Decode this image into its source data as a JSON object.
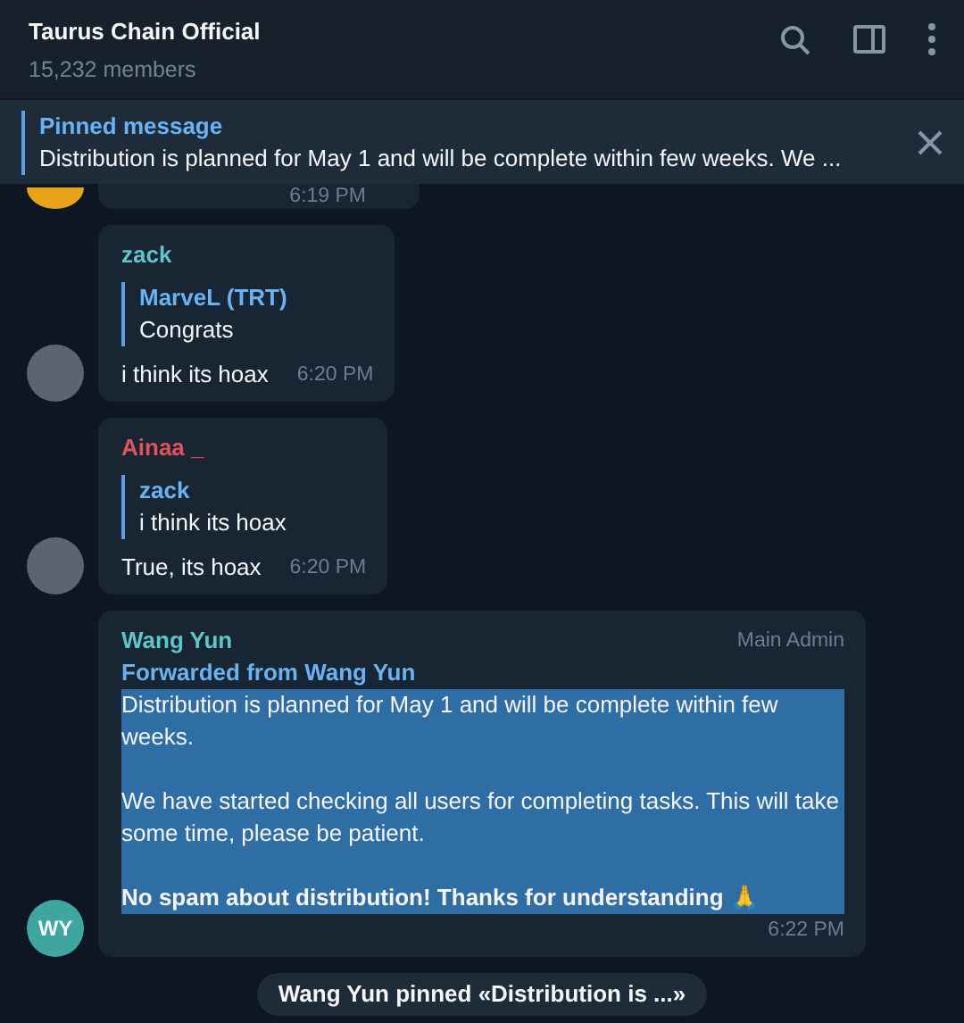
{
  "header": {
    "title": "Taurus Chain Official",
    "subtitle": "15,232 members"
  },
  "pinned": {
    "label": "Pinned message",
    "text": "Distribution is planned for May 1 and will be complete within few weeks.  We ..."
  },
  "messages": [
    {
      "kind": "partial",
      "time": "6:19 PM"
    },
    {
      "kind": "reply",
      "sender": "zack",
      "color": "#5fc5c9",
      "reply_to": {
        "sender": "MarveL (TRT)",
        "text": "Congrats"
      },
      "text": "i think its hoax",
      "time": "6:20 PM"
    },
    {
      "kind": "reply",
      "sender": "Ainaa _",
      "color": "#e0535b",
      "reply_to": {
        "sender": "zack",
        "text": "i think its hoax"
      },
      "text": "True, its hoax",
      "time": "6:20 PM"
    },
    {
      "kind": "forward",
      "sender": "Wang Yun",
      "color": "#5fc5c9",
      "initials": "WY",
      "badge": "Main Admin",
      "forwarded": "Forwarded from Wang Yun",
      "selected": true,
      "paragraphs": [
        {
          "text": "Distribution is planned for May 1 and will be complete within few weeks.",
          "bold": false
        },
        {
          "text": "We have started checking all users for completing tasks. This will take some time, please be patient.",
          "bold": false
        },
        {
          "text": "No spam about distribution! Thanks for understanding 🙏",
          "bold": true
        }
      ],
      "time": "6:22 PM"
    }
  ],
  "service": "Wang Yun pinned «Distribution is ...»"
}
